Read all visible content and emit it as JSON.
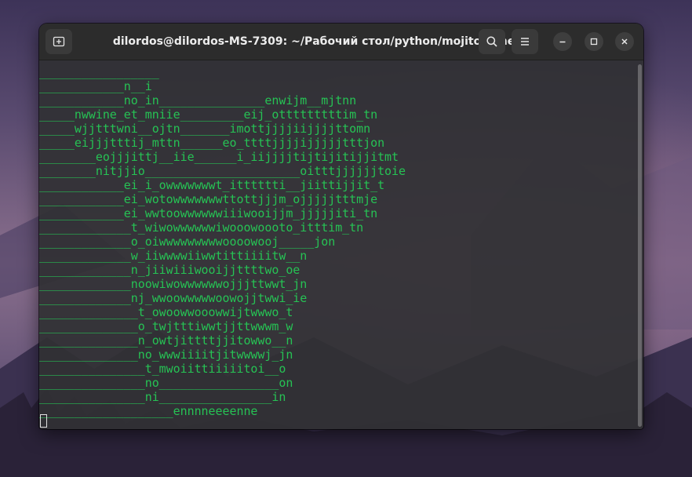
{
  "window": {
    "title": "dilordos@dilordos-MS-7309: ~/Рабочий стол/python/mojito-wine"
  },
  "icons": {
    "new_tab": "new-tab-icon",
    "search": "search-icon",
    "menu": "hamburger-menu-icon",
    "minimize": "minimize-icon",
    "maximize": "maximize-icon",
    "close": "close-icon"
  },
  "colors": {
    "terminal_text": "#26c254",
    "titlebar": "#2c2c2c"
  },
  "terminal": {
    "lines": [
      "_________________",
      "____________n__i",
      "____________no_in_______________enwijm__mjtnn",
      "_____nwwine_et_mniie_________eij_otttttttttim_tn",
      "_____wjjtttwni__ojtn_______imottjjjjiijjjjttomn",
      "_____eijjjtttij_mttn______eo_ttttjjjjijjjjjtttjon",
      "________eojjjittj__iie______i_iijjjjtijtijitijjitmt",
      "________nitjjio______________________oitttjjjjjjtoie",
      "____________ei_i_owwwwwwwt_itttttti__jiittijjit_t",
      "____________ei_wotowwwwwwwttottjjjm_ojjjjjtttmje",
      "____________ei_wwtoowwwwwwiiiwooijjm_jjjjjiti_tn",
      "_____________t_wiwowwwwwwiwooowoooto_itttim_tn",
      "_____________o_oiwwwwwwwwwoooowooj_____jon",
      "_____________w_iiwwwwiiwwtittiiiitw__n",
      "_____________n_jiiwiiiwooijjttttwo_oe",
      "_____________noowiwowwwwwwojjjttwwt_jn",
      "_____________nj_wwoowwwwwoowojjtwwi_ie",
      "______________t_owoowwooowwijtwwwo_t",
      "______________o_twjtttiwwtjjttwwwm_w",
      "______________n_owtjittttjjitowwo__n",
      "______________no_wwwiiiitjitwwwwj_jn",
      "_______________t_mwoiittiiiiitoi__o",
      "_______________no_________________on",
      "_______________ni________________in",
      "___________________ennnneeeenne"
    ]
  }
}
